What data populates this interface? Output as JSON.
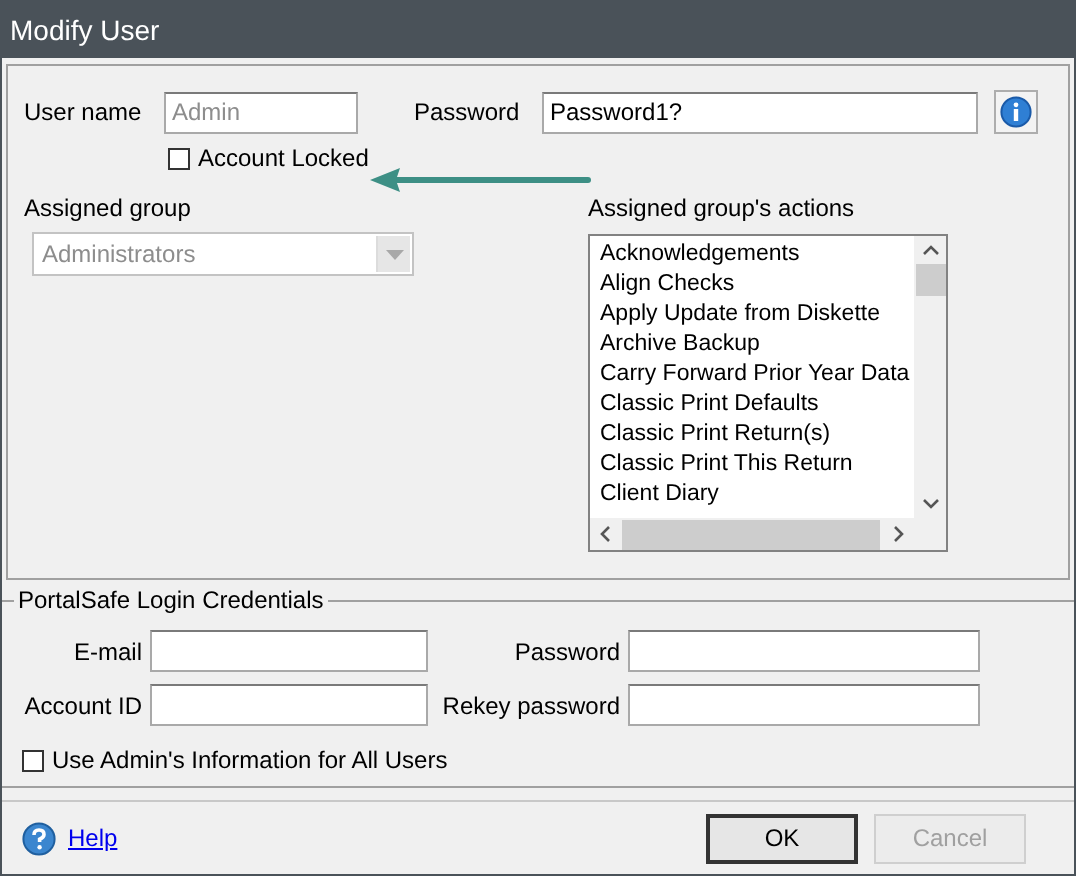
{
  "window": {
    "title": "Modify User"
  },
  "user": {
    "user_name_label": "User name",
    "user_name": "Admin",
    "user_name_disabled": true,
    "password_label": "Password",
    "password": "Password1?"
  },
  "account_locked": {
    "label": "Account Locked",
    "checked": false
  },
  "assigned_group": {
    "label": "Assigned group",
    "value": "Administrators",
    "disabled": true
  },
  "actions": {
    "label": "Assigned group's actions",
    "items": [
      "Acknowledgements",
      "Align Checks",
      "Apply Update from Diskette",
      "Archive Backup",
      "Carry Forward Prior Year Data",
      "Classic Print Defaults",
      "Classic Print Return(s)",
      "Classic Print This Return",
      "Client Diary"
    ]
  },
  "portalsafe": {
    "title": "PortalSafe Login Credentials",
    "fields": [
      {
        "label": "E-mail"
      },
      {
        "label": "Password"
      },
      {
        "label": "Account ID"
      },
      {
        "label": "Rekey password"
      }
    ]
  },
  "use_admin_info": {
    "label": "Use Admin's Information for All Users",
    "checked": false
  },
  "help_link": "Help",
  "buttons": [
    {
      "label": "OK",
      "disabled": false
    },
    {
      "label": "Cancel",
      "disabled": true
    }
  ]
}
